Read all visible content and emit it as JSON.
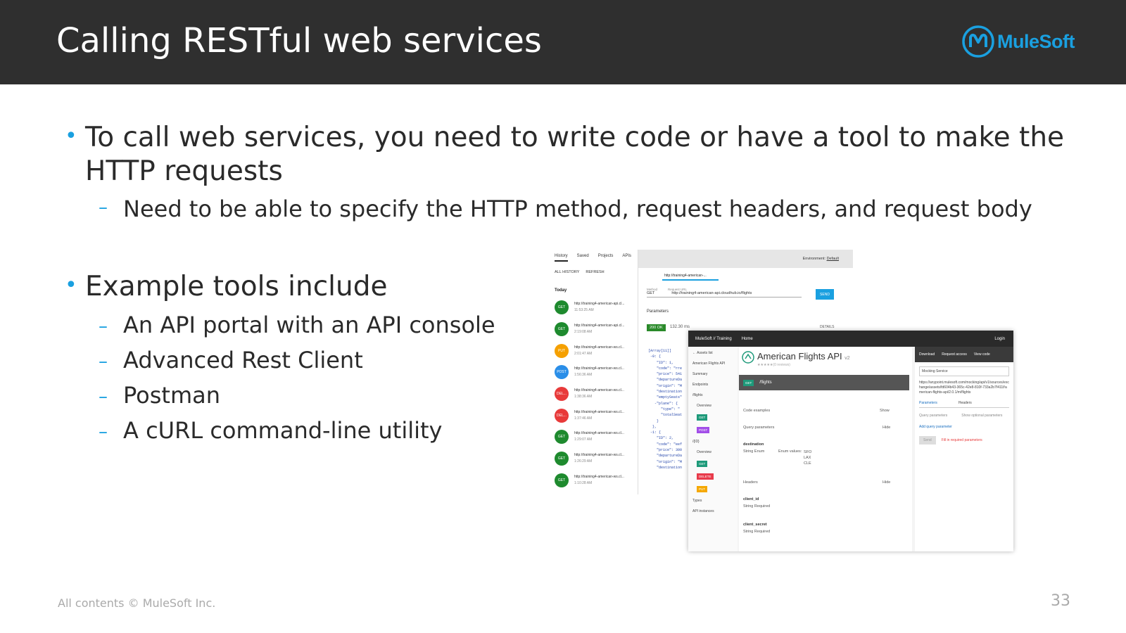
{
  "slide": {
    "title": "Calling RESTful web services",
    "logo_text": "MuleSoft",
    "bullets": [
      {
        "text": "To call web services, you need to write code or have a tool to make the HTTP requests",
        "subs": [
          "Need to be able to specify the HTTP method, request headers, and request body"
        ]
      },
      {
        "text": "Example tools include",
        "subs": [
          "An API portal with an API console",
          "Advanced Rest Client",
          "Postman",
          "A cURL command-line utility"
        ]
      }
    ],
    "footer": "All contents © MuleSoft Inc.",
    "page_number": "33"
  },
  "arc": {
    "tabs": [
      "History",
      "Saved",
      "Projects",
      "APIs"
    ],
    "sub": [
      "ALL HISTORY",
      "REFRESH"
    ],
    "today": "Today",
    "history": [
      {
        "method": "GET",
        "url": "http://training4-american-api.cl...",
        "time": "11:53:25 AM",
        "color": "#1e8a2e"
      },
      {
        "method": "GET",
        "url": "http://training4-american-api.cl...",
        "time": "2:19:08 AM",
        "color": "#1e8a2e"
      },
      {
        "method": "PUT",
        "url": "http://training4-american-ws.cl...",
        "time": "2:01:47 AM",
        "color": "#f5a000"
      },
      {
        "method": "POST",
        "url": "http://training4-american-ws.cl...",
        "time": "1:56:36 AM",
        "color": "#2a8ee8"
      },
      {
        "method": "DEL...",
        "url": "http://training4-american-ws.cl...",
        "time": "1:38:36 AM",
        "color": "#e83a3a"
      },
      {
        "method": "DEL...",
        "url": "http://training4-american-ws.cl...",
        "time": "1:37:46 AM",
        "color": "#e83a3a"
      },
      {
        "method": "GET",
        "url": "http://training4-american-ws.cl...",
        "time": "1:29:07 AM",
        "color": "#1e8a2e"
      },
      {
        "method": "GET",
        "url": "http://training4-american-ws.cl...",
        "time": "1:26:29 AM",
        "color": "#1e8a2e"
      },
      {
        "method": "GET",
        "url": "http://training4-american-ws.cl...",
        "time": "1:10:28 AM",
        "color": "#1e8a2e"
      }
    ],
    "environment_label": "Environment:",
    "environment_value": "Default",
    "url_tab": "http://training4-american-...",
    "method_label": "Method",
    "method_value": "GET",
    "request_url_label": "Request URL",
    "request_url": "http://training4-american-api.cloudhub.io/flights",
    "send": "SEND",
    "parameters": "Parameters",
    "status": "200 OK",
    "time": "132.30 ms",
    "details": "DETAILS",
    "code": "[Array[11]]\n -0: {\n    \"ID\": 1,\n    \"code\": \"rre\n    \"price\": 541\n    \"departureDa\n    \"origin\": \"M\n    \"destination\n    \"emptySeats\"\n   -\"plane\": {\n      \"type\": \"\n      \"totalSeat\n    }\n  },\n -1: {\n    \"ID\": 2,\n    \"code\": \"eef\n    \"price\": 300\n    \"departureDa\n    \"origin\": \"M\n    \"destination"
  },
  "exchange": {
    "brand": "MuleSoft // Training",
    "home": "Home",
    "login": "Login",
    "side": [
      "← Assets list",
      "American Flights API",
      "Summary",
      "Endpoints",
      "/flights",
      "Overview",
      "/{ID}",
      "Overview",
      "Types",
      "API instances"
    ],
    "api_title": "American Flights API",
    "version": "v2",
    "reviews": "(0 reviews)",
    "endpoint_method": "GET",
    "endpoint_path": "/flights",
    "code_examples": "Code examples",
    "show": "Show",
    "query_parameters": "Query parameters",
    "hide": "Hide",
    "destination": "destination",
    "string": "String",
    "enum": "Enum",
    "enum_values_label": "Enum values:",
    "enum_values": [
      "SFO",
      "LAX",
      "CLE"
    ],
    "headers": "Headers",
    "client_id": "client_id",
    "client_secret": "client_secret",
    "required": "Required",
    "download": "Download",
    "request_access": "Request access",
    "view_code": "View code",
    "mocking": "Mocking Service",
    "mock_url": "https://anypoint.mulesoft.com/mocking/api/v1/sources/exchange/assets/fd604b43-365c-42e8-810f-733a2b7f411f/american-flights-api/2.0.1/m/flights",
    "tab_params": "Parameters",
    "tab_headers": "Headers",
    "query_label": "Query parameters",
    "show_optional": "Show optional parameters",
    "add_query": "Add query parameter",
    "send": "Send",
    "fill_required": "Fill in required parameters"
  }
}
